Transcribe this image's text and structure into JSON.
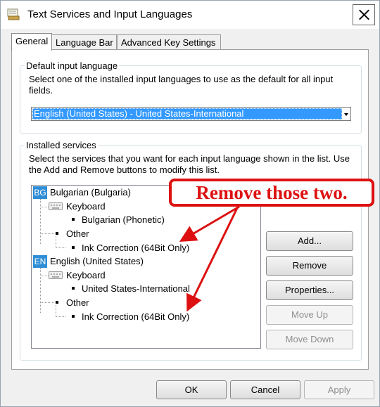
{
  "window": {
    "title": "Text Services and Input Languages"
  },
  "tabs": [
    {
      "label": "General",
      "active": true
    },
    {
      "label": "Language Bar",
      "active": false
    },
    {
      "label": "Advanced Key Settings",
      "active": false
    }
  ],
  "default_input": {
    "legend": "Default input language",
    "description_line1": "Select one of the installed input languages to use as the default for all input",
    "description_line2": "fields.",
    "selected_value": "English (United States) - United States-International"
  },
  "installed": {
    "legend": "Installed services",
    "description_line1": "Select the services that you want for each input language shown in the list. Use",
    "description_line2": "the Add and Remove buttons to modify this list."
  },
  "tree": {
    "languages": [
      {
        "badge": "BG",
        "name": "Bulgarian (Bulgaria)",
        "keyboard_label": "Keyboard",
        "keyboard_item": "Bulgarian (Phonetic)",
        "other_label": "Other",
        "other_item": "Ink Correction (64Bit Only)"
      },
      {
        "badge": "EN",
        "name": "English (United States)",
        "keyboard_label": "Keyboard",
        "keyboard_item": "United States-International",
        "other_label": "Other",
        "other_item": "Ink Correction (64Bit Only)"
      }
    ]
  },
  "side_buttons": {
    "add": "Add...",
    "remove": "Remove",
    "properties": "Properties...",
    "move_up": "Move Up",
    "move_down": "Move Down"
  },
  "footer": {
    "ok": "OK",
    "cancel": "Cancel",
    "apply": "Apply"
  },
  "annotation": {
    "text": "Remove those two.",
    "color": "#dd1111"
  },
  "colors": {
    "selection": "#3399ff",
    "badge": "#2f8dd6"
  }
}
